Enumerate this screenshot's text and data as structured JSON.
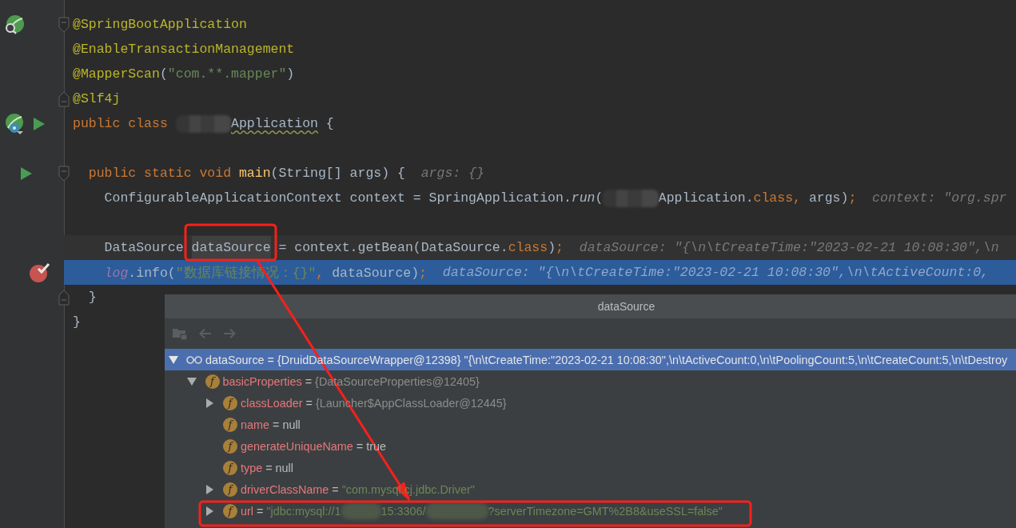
{
  "lines": [
    {
      "kind": "plain",
      "gutter": [
        {
          "kind": "bean-search"
        }
      ],
      "fold": {
        "kind": "start"
      },
      "tokens": [
        {
          "text": "@SpringBootApplication",
          "kind": "annotation"
        }
      ]
    },
    {
      "kind": "plain",
      "tokens": [
        {
          "text": "@EnableTransactionManagement",
          "kind": "annotation"
        }
      ]
    },
    {
      "kind": "plain",
      "tokens": [
        {
          "text": "@MapperScan",
          "kind": "annotation"
        },
        {
          "text": "(",
          "kind": "plain"
        },
        {
          "text": "\"com.**.mapper\"",
          "kind": "string"
        },
        {
          "text": ")",
          "kind": "plain"
        }
      ]
    },
    {
      "kind": "plain",
      "fold": {
        "kind": "end"
      },
      "tokens": [
        {
          "text": "@Slf4j",
          "kind": "annotation"
        }
      ]
    },
    {
      "kind": "plain",
      "gutter": [
        {
          "kind": "bean-class"
        },
        {
          "kind": "run"
        }
      ],
      "tokens": [
        {
          "text": "public class ",
          "kind": "keyword"
        },
        {
          "kind": "redacted"
        },
        {
          "text": "Application",
          "kind": "typo"
        },
        {
          "text": " {",
          "kind": "plain"
        }
      ]
    },
    {
      "kind": "plain"
    },
    {
      "kind": "plain",
      "gutter": [
        {
          "kind": "run"
        }
      ],
      "fold": {
        "kind": "start"
      },
      "tokens": [
        {
          "text": "  public static void ",
          "kind": "keyword"
        },
        {
          "text": "main",
          "kind": "method"
        },
        {
          "text": "(String[] args) {",
          "kind": "plain"
        },
        {
          "text": "args: {}",
          "kind": "hint"
        }
      ]
    },
    {
      "kind": "plain",
      "tokens": [
        {
          "text": "    ConfigurableApplicationContext context = SpringApplication.",
          "kind": "plain"
        },
        {
          "text": "run",
          "kind": "static-call"
        },
        {
          "text": "(",
          "kind": "plain"
        },
        {
          "kind": "redacted"
        },
        {
          "text": "Application.",
          "kind": "plain"
        },
        {
          "text": "class",
          "kind": "keyword"
        },
        {
          "text": ",",
          "kind": "keyword"
        },
        {
          "text": " args)",
          "kind": "plain"
        },
        {
          "text": ";",
          "kind": "keyword"
        },
        {
          "text": "context: \"org.spr",
          "kind": "hint"
        }
      ]
    },
    {
      "kind": "plain"
    },
    {
      "kind": "caret",
      "tokens": [
        {
          "text": "    DataSource ",
          "kind": "plain"
        },
        {
          "text": "dataSource",
          "kind": "usage"
        },
        {
          "text": " = context.getBean(DataSource.",
          "kind": "plain"
        },
        {
          "text": "class",
          "kind": "keyword"
        },
        {
          "text": ")",
          "kind": "plain"
        },
        {
          "text": ";",
          "kind": "keyword"
        },
        {
          "text": "dataSource: \"{\\n\\tCreateTime:\"2023-02-21 10:08:30\",\\n",
          "kind": "hint"
        }
      ]
    },
    {
      "kind": "execution",
      "gutter": [
        {
          "kind": "breakpoint"
        }
      ],
      "tokens": [
        {
          "text": "    log",
          "kind": "field"
        },
        {
          "text": ".info(",
          "kind": "plain"
        },
        {
          "text": "\"数据库链接情况：{}\"",
          "kind": "string"
        },
        {
          "text": ",",
          "kind": "keyword"
        },
        {
          "text": " dataSource)",
          "kind": "plain"
        },
        {
          "text": ";",
          "kind": "keyword"
        },
        {
          "text": "dataSource: \"{\\n\\tCreateTime:\"2023-02-21 10:08:30\",\\n\\tActiveCount:0,",
          "kind": "hint"
        }
      ]
    },
    {
      "kind": "plain",
      "fold": {
        "kind": "end"
      },
      "tokens": [
        {
          "text": "  }",
          "kind": "plain"
        }
      ]
    },
    {
      "kind": "plain",
      "tokens": [
        {
          "text": "}",
          "kind": "plain"
        }
      ]
    }
  ],
  "popup": {
    "title": "dataSource",
    "toolbar": [
      {
        "kind": "folder",
        "disabled": true
      },
      {
        "kind": "back",
        "disabled": true
      },
      {
        "kind": "forward",
        "disabled": true
      }
    ],
    "tree": [
      {
        "kind": "branch",
        "expanded": true,
        "selected": true,
        "icon": {
          "kind": "watch"
        },
        "name": "dataSource",
        "op": "=",
        "value": [
          {
            "kind": "object",
            "text": "{DruidDataSourceWrapper@12398} \"{\\n\\tCreateTime:\"2023-02-21 10:08:30\",\\n\\tActiveCount:0,\\n\\tPoolingCount:5,\\n\\tCreateCount:5,\\n\\tDestroy"
          }
        ],
        "children": [
          {
            "kind": "branch",
            "expanded": true,
            "selected": false,
            "icon": {
              "kind": "field",
              "letter": "f"
            },
            "name": "basicProperties",
            "op": "=",
            "value": [
              {
                "kind": "object",
                "text": "{DataSourceProperties@12405}"
              }
            ],
            "children": [
              {
                "kind": "branch",
                "expanded": false,
                "selected": false,
                "icon": {
                  "kind": "field",
                  "letter": "f"
                },
                "name": "classLoader",
                "op": "=",
                "value": [
                  {
                    "kind": "object",
                    "text": "{Launcher$AppClassLoader@12445}"
                  }
                ]
              },
              {
                "kind": "leaf",
                "selected": false,
                "icon": {
                  "kind": "field",
                  "letter": "f"
                },
                "name": "name",
                "op": "=",
                "value": [
                  {
                    "kind": "literal",
                    "text": "null"
                  }
                ]
              },
              {
                "kind": "leaf",
                "selected": false,
                "icon": {
                  "kind": "field",
                  "letter": "f"
                },
                "name": "generateUniqueName",
                "op": "=",
                "value": [
                  {
                    "kind": "literal",
                    "text": "true"
                  }
                ]
              },
              {
                "kind": "leaf",
                "selected": false,
                "icon": {
                  "kind": "field",
                  "letter": "f"
                },
                "name": "type",
                "op": "=",
                "value": [
                  {
                    "kind": "literal",
                    "text": "null"
                  }
                ]
              },
              {
                "kind": "branch",
                "expanded": false,
                "selected": false,
                "icon": {
                  "kind": "field",
                  "letter": "f"
                },
                "name": "driverClassName",
                "op": "=",
                "value": [
                  {
                    "kind": "string",
                    "text": "\"com.mysql.cj.jdbc.Driver\""
                  }
                ]
              },
              {
                "kind": "branch",
                "expanded": false,
                "selected": false,
                "icon": {
                  "kind": "field",
                  "letter": "f"
                },
                "name": "url",
                "op": "=",
                "value": [
                  {
                    "kind": "string",
                    "text": "\"jdbc:mysql://1"
                  },
                  {
                    "kind": "redacted"
                  },
                  {
                    "kind": "string",
                    "text": "15:3306/"
                  },
                  {
                    "kind": "redacted"
                  },
                  {
                    "kind": "string",
                    "text": "?serverTimezone=GMT%2B8&useSSL=false\""
                  }
                ]
              }
            ]
          }
        ]
      }
    ]
  },
  "annotations": [
    {
      "kind": "highlight-box"
    },
    {
      "kind": "arrow"
    },
    {
      "kind": "highlight-box"
    }
  ]
}
